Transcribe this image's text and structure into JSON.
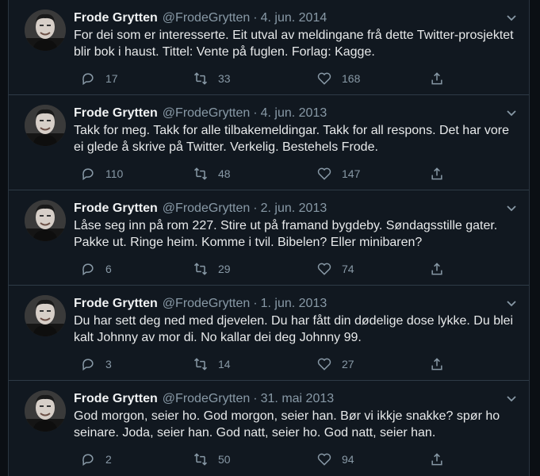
{
  "tweets": [
    {
      "name": "Frode Grytten",
      "handle": "@FrodeGrytten",
      "date": "4. jun. 2014",
      "text": "For dei som er interesserte. Eit utval av meldingane frå dette Twitter-prosjektet blir bok i haust. Tittel: Vente på fuglen. Forlag: Kagge.",
      "replies": "17",
      "retweets": "33",
      "likes": "168"
    },
    {
      "name": "Frode Grytten",
      "handle": "@FrodeGrytten",
      "date": "4. jun. 2013",
      "text": "Takk for meg. Takk for alle tilbakemeldingar. Takk for all respons. Det har vore ei glede å skrive på Twitter. Verkelig. Bestehels Frode.",
      "replies": "110",
      "retweets": "48",
      "likes": "147"
    },
    {
      "name": "Frode Grytten",
      "handle": "@FrodeGrytten",
      "date": "2. jun. 2013",
      "text": "Låse seg inn på rom 227. Stire ut på framand bygdeby. Søndagsstille gater. Pakke ut. Ringe heim. Komme i tvil. Bibelen? Eller minibaren?",
      "replies": "6",
      "retweets": "29",
      "likes": "74"
    },
    {
      "name": "Frode Grytten",
      "handle": "@FrodeGrytten",
      "date": "1. jun. 2013",
      "text": "Du har sett deg ned med djevelen. Du har fått din dødelige dose lykke. Du blei kalt Johnny av mor di. No kallar dei deg Johnny 99.",
      "replies": "3",
      "retweets": "14",
      "likes": "27"
    },
    {
      "name": "Frode Grytten",
      "handle": "@FrodeGrytten",
      "date": "31. mai 2013",
      "text": "God morgon, seier ho. God morgon, seier han. Bør vi ikkje snakke? spør ho seinare. Joda, seier han. God natt, seier ho. God natt, seier han.",
      "replies": "2",
      "retweets": "50",
      "likes": "94"
    }
  ],
  "separator": "·",
  "icons": {
    "reply": "reply-icon",
    "retweet": "retweet-icon",
    "like": "heart-icon",
    "share": "share-icon",
    "more": "chevron-down-icon"
  },
  "colors": {
    "background": "#111820",
    "text": "#e7e9ea",
    "muted": "#8899a6",
    "divider": "#2f3b47"
  }
}
